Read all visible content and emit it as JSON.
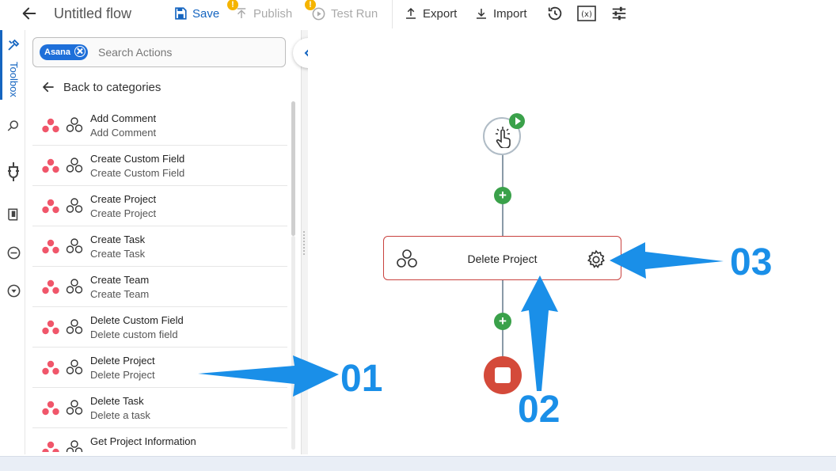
{
  "toolbar": {
    "title": "Untitled flow",
    "save": "Save",
    "publish": "Publish",
    "test_run": "Test Run",
    "export": "Export",
    "import": "Import",
    "warning_badge": "!"
  },
  "rail": {
    "toolbox_label": "Toolbox",
    "icons": [
      "toolbox-icon",
      "search-icon",
      "plug-icon",
      "book-icon",
      "minus-circle-icon",
      "arrow-down-circle-icon"
    ]
  },
  "panel": {
    "chip": "Asana",
    "search_placeholder": "Search Actions",
    "back_label": "Back to categories",
    "items": [
      {
        "title": "Add Comment",
        "subtitle": "Add Comment"
      },
      {
        "title": "Create Custom Field",
        "subtitle": "Create Custom Field"
      },
      {
        "title": "Create Project",
        "subtitle": "Create Project"
      },
      {
        "title": "Create Task",
        "subtitle": "Create Task"
      },
      {
        "title": "Create Team",
        "subtitle": "Create Team"
      },
      {
        "title": "Delete Custom Field",
        "subtitle": "Delete custom field"
      },
      {
        "title": "Delete Project",
        "subtitle": "Delete Project"
      },
      {
        "title": "Delete Task",
        "subtitle": "Delete a task"
      },
      {
        "title": "Get Project Information",
        "subtitle": ""
      }
    ]
  },
  "canvas": {
    "action_label": "Delete Project",
    "plus": "+"
  },
  "annotations": {
    "label_01": "01",
    "label_02": "02",
    "label_03": "03"
  },
  "colors": {
    "accent": "#1565c0",
    "chip": "#1e6fd9",
    "success": "#3aa14a",
    "danger": "#d44a3a",
    "action_border": "#c9423f",
    "annotation": "#1a8fe8",
    "warning": "#f5b400"
  }
}
